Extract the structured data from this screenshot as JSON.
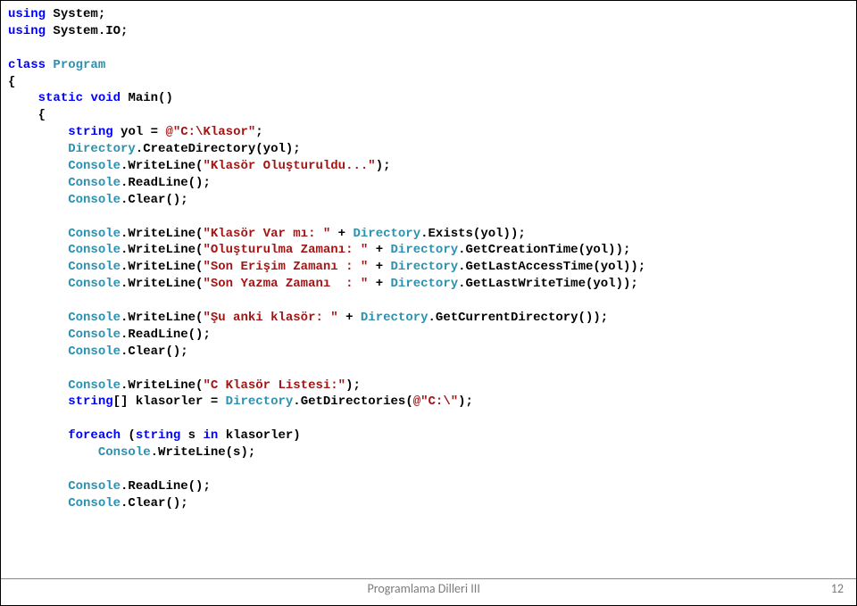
{
  "code": {
    "l1a": "using",
    "l1b": " System;",
    "l2a": "using",
    "l2b": " System.IO;",
    "blank1": "",
    "l3a": "class",
    "l3b": " ",
    "l3c": "Program",
    "l4": "{",
    "l5a": "    ",
    "l5b": "static",
    "l5c": " ",
    "l5d": "void",
    "l5e": " Main()",
    "l6": "    {",
    "l7a": "        ",
    "l7b": "string",
    "l7c": " yol = ",
    "l7d": "@\"C:\\Klasor\"",
    "l7e": ";",
    "l8a": "        ",
    "l8b": "Directory",
    "l8c": ".CreateDirectory(yol);",
    "l9a": "        ",
    "l9b": "Console",
    "l9c": ".WriteLine(",
    "l9d": "\"Klasör Oluşturuldu...\"",
    "l9e": ");",
    "l10a": "        ",
    "l10b": "Console",
    "l10c": ".ReadLine();",
    "l11a": "        ",
    "l11b": "Console",
    "l11c": ".Clear();",
    "blank2": "",
    "l12a": "        ",
    "l12b": "Console",
    "l12c": ".WriteLine(",
    "l12d": "\"Klasör Var mı: \"",
    "l12e": " + ",
    "l12f": "Directory",
    "l12g": ".Exists(yol));",
    "l13a": "        ",
    "l13b": "Console",
    "l13c": ".WriteLine(",
    "l13d": "\"Oluşturulma Zamanı: \"",
    "l13e": " + ",
    "l13f": "Directory",
    "l13g": ".GetCreationTime(yol));",
    "l14a": "        ",
    "l14b": "Console",
    "l14c": ".WriteLine(",
    "l14d": "\"Son Erişim Zamanı : \"",
    "l14e": " + ",
    "l14f": "Directory",
    "l14g": ".GetLastAccessTime(yol));",
    "l15a": "        ",
    "l15b": "Console",
    "l15c": ".WriteLine(",
    "l15d": "\"Son Yazma Zamanı  : \"",
    "l15e": " + ",
    "l15f": "Directory",
    "l15g": ".GetLastWriteTime(yol));",
    "blank3": "",
    "l16a": "        ",
    "l16b": "Console",
    "l16c": ".WriteLine(",
    "l16d": "\"Şu anki klasör: \"",
    "l16e": " + ",
    "l16f": "Directory",
    "l16g": ".GetCurrentDirectory());",
    "l17a": "        ",
    "l17b": "Console",
    "l17c": ".ReadLine();",
    "l18a": "        ",
    "l18b": "Console",
    "l18c": ".Clear();",
    "blank4": "",
    "l19a": "        ",
    "l19b": "Console",
    "l19c": ".WriteLine(",
    "l19d": "\"C Klasör Listesi:\"",
    "l19e": ");",
    "l20a": "        ",
    "l20b": "string",
    "l20c": "[] klasorler = ",
    "l20d": "Directory",
    "l20e": ".GetDirectories(",
    "l20f": "@\"C:\\\"",
    "l20g": ");",
    "blank5": "",
    "l21a": "        ",
    "l21b": "foreach",
    "l21c": " (",
    "l21d": "string",
    "l21e": " s ",
    "l21f": "in",
    "l21g": " klasorler)",
    "l22a": "            ",
    "l22b": "Console",
    "l22c": ".WriteLine(s);",
    "blank6": "",
    "l23a": "        ",
    "l23b": "Console",
    "l23c": ".ReadLine();",
    "l24a": "        ",
    "l24b": "Console",
    "l24c": ".Clear();"
  },
  "footer": {
    "title": "Programlama Dilleri III",
    "page": "12"
  }
}
